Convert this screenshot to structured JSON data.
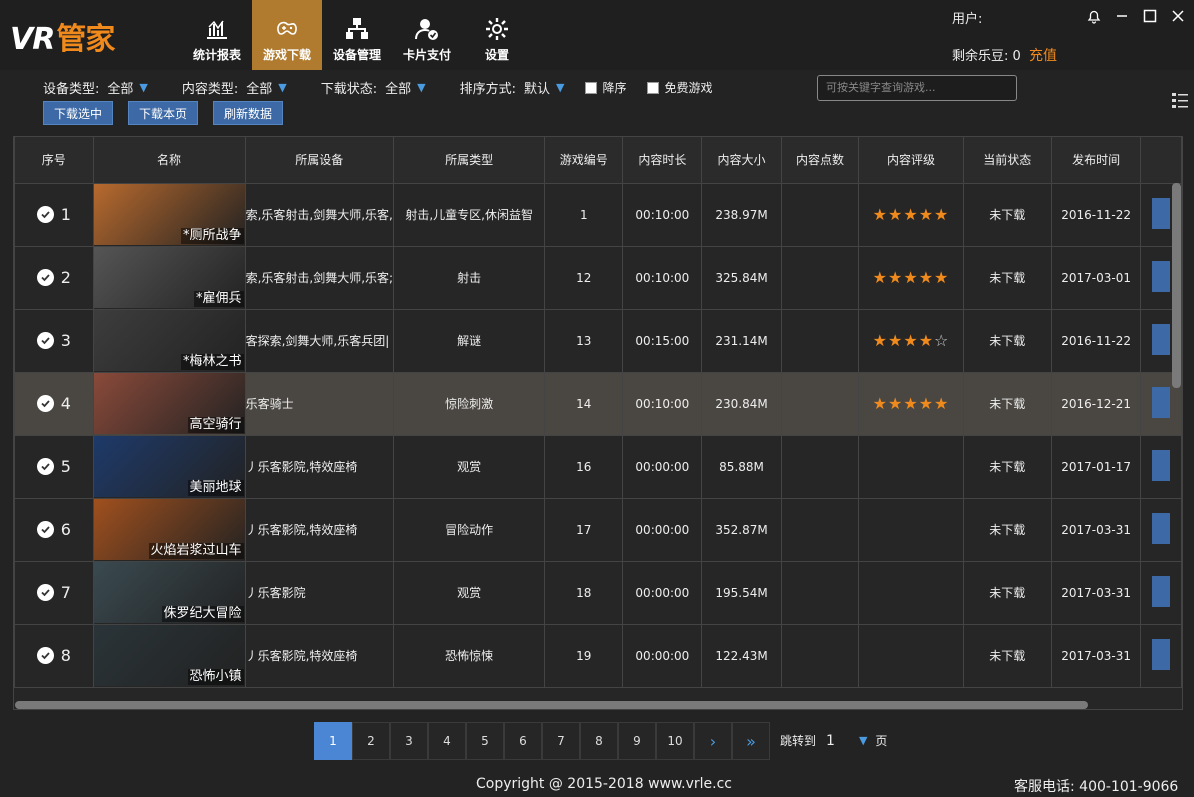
{
  "app": {
    "logo_vr": "VR",
    "logo_name": "管家"
  },
  "nav": [
    {
      "label": "统计报表",
      "icon": "chart-icon",
      "active": false
    },
    {
      "label": "游戏下载",
      "icon": "gamepad-icon",
      "active": true
    },
    {
      "label": "设备管理",
      "icon": "devices-icon",
      "active": false
    },
    {
      "label": "卡片支付",
      "icon": "card-pay-icon",
      "active": false
    },
    {
      "label": "设置",
      "icon": "gear-icon",
      "active": false
    }
  ],
  "user": {
    "user_label": "用户:",
    "beans_label": "剩余乐豆:",
    "beans_value": "0",
    "recharge": "充值"
  },
  "filters": {
    "device_type_label": "设备类型:",
    "device_type_value": "全部",
    "content_type_label": "内容类型:",
    "content_type_value": "全部",
    "download_status_label": "下载状态:",
    "download_status_value": "全部",
    "sort_label": "排序方式:",
    "sort_value": "默认",
    "desc_label": "降序",
    "free_label": "免费游戏",
    "search_placeholder": "可按关键字查询游戏..."
  },
  "buttons": {
    "download_selected": "下载选中",
    "download_page": "下载本页",
    "refresh": "刷新数据"
  },
  "table": {
    "headers": [
      "序号",
      "名称",
      "所属设备",
      "所属类型",
      "游戏编号",
      "内容时长",
      "内容大小",
      "内容点数",
      "内容评级",
      "当前状态",
      "发布时间"
    ],
    "rows": [
      {
        "idx": "1",
        "title": "*厕所战争",
        "device": "索,乐客射击,剑舞大师,乐客,",
        "type": "射击,儿童专区,休闲益智",
        "game_no": "1",
        "duration": "00:10:00",
        "size": "238.97M",
        "points": "",
        "rating": 5,
        "status": "未下载",
        "date": "2016-11-22",
        "thumb": "#b86a2e"
      },
      {
        "idx": "2",
        "title": "*雇佣兵",
        "device": "索,乐客射击,剑舞大师,乐客;",
        "type": "射击",
        "game_no": "12",
        "duration": "00:10:00",
        "size": "325.84M",
        "points": "",
        "rating": 5,
        "status": "未下载",
        "date": "2017-03-01",
        "thumb": "#555"
      },
      {
        "idx": "3",
        "title": "*梅林之书",
        "device": "客探索,剑舞大师,乐客兵团|",
        "type": "解谜",
        "game_no": "13",
        "duration": "00:15:00",
        "size": "231.14M",
        "points": "",
        "rating": 4,
        "status": "未下载",
        "date": "2016-11-22",
        "thumb": "#3d3d3d"
      },
      {
        "idx": "4",
        "title": "高空骑行",
        "device": "乐客骑士",
        "type": "惊险刺激",
        "game_no": "14",
        "duration": "00:10:00",
        "size": "230.84M",
        "points": "",
        "rating": 5,
        "status": "未下载",
        "date": "2016-12-21",
        "thumb": "#8a4a3a"
      },
      {
        "idx": "5",
        "title": "美丽地球",
        "device": "丿乐客影院,特效座椅",
        "type": "观赏",
        "game_no": "16",
        "duration": "00:00:00",
        "size": "85.88M",
        "points": "",
        "rating": 0,
        "status": "未下载",
        "date": "2017-01-17",
        "thumb": "#1e3a6a"
      },
      {
        "idx": "6",
        "title": "火焰岩浆过山车",
        "device": "丿乐客影院,特效座椅",
        "type": "冒险动作",
        "game_no": "17",
        "duration": "00:00:00",
        "size": "352.87M",
        "points": "",
        "rating": 0,
        "status": "未下载",
        "date": "2017-03-31",
        "thumb": "#a0501e"
      },
      {
        "idx": "7",
        "title": "侏罗纪大冒险",
        "device": "丿乐客影院",
        "type": "观赏",
        "game_no": "18",
        "duration": "00:00:00",
        "size": "195.54M",
        "points": "",
        "rating": 0,
        "status": "未下载",
        "date": "2017-03-31",
        "thumb": "#3a4a50"
      },
      {
        "idx": "8",
        "title": "恐怖小镇",
        "device": "丿乐客影院,特效座椅",
        "type": "恐怖惊悚",
        "game_no": "19",
        "duration": "00:00:00",
        "size": "122.43M",
        "points": "",
        "rating": 0,
        "status": "未下载",
        "date": "2017-03-31",
        "thumb": "#2a3438"
      }
    ]
  },
  "pager": {
    "pages": [
      "1",
      "2",
      "3",
      "4",
      "5",
      "6",
      "7",
      "8",
      "9",
      "10"
    ],
    "current": "1",
    "next": "›",
    "last": "»",
    "jump_label": "跳转到",
    "jump_value": "1",
    "page_unit": "页"
  },
  "footer": {
    "copyright": "Copyright @ 2015-2018 www.vrle.cc",
    "hotline": "客服电话: 400-101-9066"
  },
  "colors": {
    "accent": "#f08a1c",
    "nav_active": "#b07b2e",
    "button": "#3d6aa6",
    "page_active": "#4a86d4"
  }
}
